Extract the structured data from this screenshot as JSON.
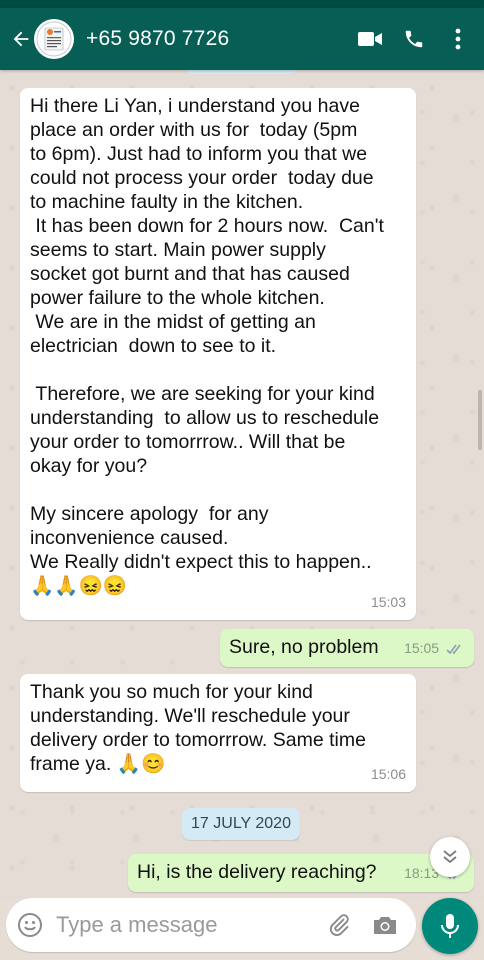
{
  "header": {
    "contact_name": "+65 9870 7726",
    "avatar_icon": "restaurant-menu-logo",
    "actions": [
      "video-call-icon",
      "phone-call-icon",
      "more-options-icon"
    ]
  },
  "messages": [
    {
      "direction": "incoming",
      "text": "Hi there Li Yan, i understand you have\nplace an order with us for  today (5pm\nto 6pm). Just had to inform you that we\ncould not process your order  today due\nto machine faulty in the kitchen.\n It has been down for 2 hours now.  Can't\nseems to start. Main power supply\nsocket got burnt and that has caused\npower failure to the whole kitchen.\n We are in the midst of getting an\nelectrician  down to see to it.\n\n Therefore, we are seeking for your kind\nunderstanding  to allow us to reschedule\nyour order to tomorrrow.. Will that be\nokay for you?\n\nMy sincere apology  for any\ninconvenience caused.\nWe Really didn't expect this to happen..\n🙏🙏😖😖",
      "time": "15:03"
    },
    {
      "direction": "outgoing",
      "text": "Sure, no problem",
      "time": "15:05",
      "status": "read"
    },
    {
      "direction": "incoming",
      "text": "Thank you so much for your kind\nunderstanding. We'll reschedule your\ndelivery order to tomorrrow. Same time\nframe ya. 🙏😊",
      "time": "15:06"
    },
    {
      "direction": "outgoing",
      "text": "Hi, is the delivery reaching?",
      "time": "18:13",
      "status": "read"
    }
  ],
  "date_chip": "17 JULY 2020",
  "composer": {
    "placeholder": "Type a message"
  },
  "colors": {
    "header": "#075e54",
    "outgoing_bubble": "#dcf8c6",
    "incoming_bubble": "#ffffff",
    "date_chip": "#d4eaf4",
    "mic_button": "#00897b",
    "read_ticks": "#4fc3f7"
  }
}
